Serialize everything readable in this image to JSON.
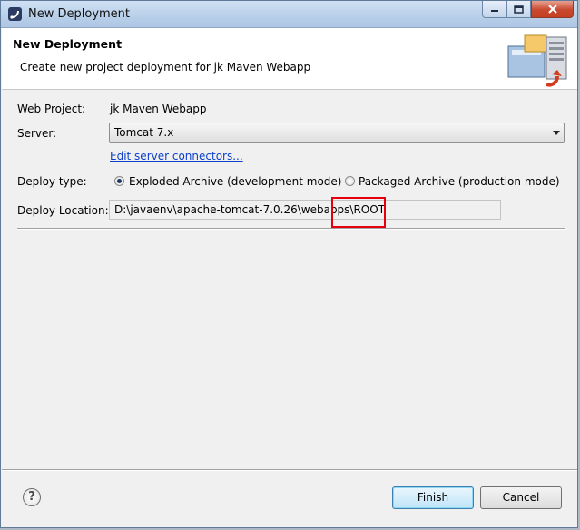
{
  "window": {
    "title": "New Deployment"
  },
  "header": {
    "title": "New Deployment",
    "description": "Create new project deployment for jk Maven Webapp",
    "graphic": "deployment-server-icon"
  },
  "form": {
    "web_project_label": "Web Project:",
    "web_project_value": "jk Maven Webapp",
    "server_label": "Server:",
    "server_value": "Tomcat  7.x",
    "edit_link": "Edit server connectors...",
    "deploy_type_label": "Deploy type:",
    "deploy_types": [
      {
        "label": "Exploded Archive (development mode)",
        "selected": true
      },
      {
        "label": "Packaged Archive (production mode)",
        "selected": false
      }
    ],
    "deploy_location_label": "Deploy Location:",
    "deploy_location_value": "D:\\javaenv\\apache-tomcat-7.0.26\\webapps\\ROOT"
  },
  "buttons": {
    "help_glyph": "?",
    "finish": "Finish",
    "cancel": "Cancel"
  },
  "colors": {
    "highlight": "#e5000b",
    "link": "#0c3fcb"
  }
}
